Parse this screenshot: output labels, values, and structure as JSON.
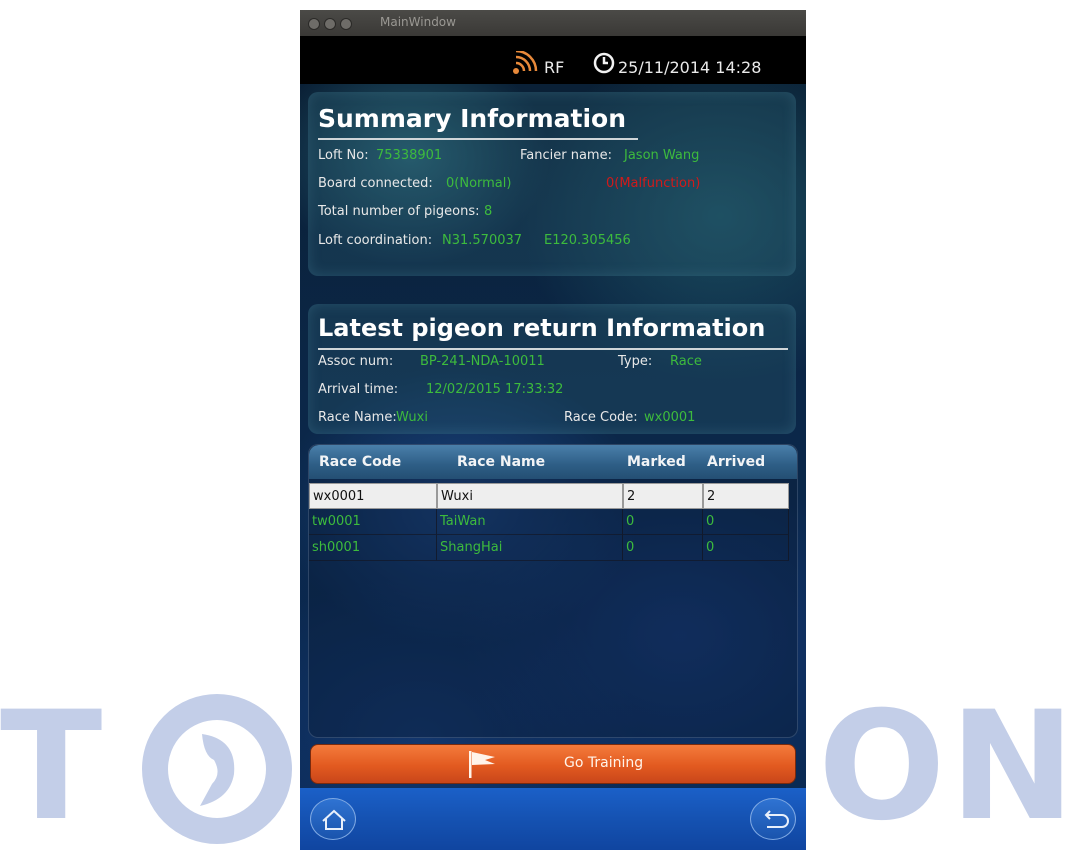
{
  "watermark": {
    "letters_left": "T",
    "letters_right": "ON"
  },
  "window": {
    "title": "MainWindow"
  },
  "status": {
    "rf_label": "RF",
    "datetime": "25/11/2014 14:28"
  },
  "summary": {
    "title": "Summary Information",
    "loft_no_label": "Loft No:",
    "loft_no": "75338901",
    "fancier_label": "Fancier name:",
    "fancier": "Jason Wang",
    "board_label": "Board connected:",
    "board_value": "0(Normal)",
    "board_error": "0(Malfunction)",
    "total_label": "Total number of pigeons:",
    "total_value": "8",
    "coord_label": "Loft coordination:",
    "coord_n": "N31.570037",
    "coord_e": "E120.305456"
  },
  "latest": {
    "title": "Latest pigeon return Information",
    "assoc_label": "Assoc num:",
    "assoc_value": "BP-241-NDA-10011",
    "type_label": "Type:",
    "type_value": "Race",
    "arrival_label": "Arrival time:",
    "arrival_value": "12/02/2015 17:33:32",
    "race_name_label": "Race Name:",
    "race_name_value": "Wuxi",
    "race_code_label": "Race Code:",
    "race_code_value": "wx0001"
  },
  "table": {
    "headers": [
      "Race Code",
      "Race Name",
      "Marked",
      "Arrived"
    ],
    "rows": [
      {
        "code": "wx0001",
        "name": "Wuxi",
        "marked": "2",
        "arrived": "2",
        "selected": true
      },
      {
        "code": "tw0001",
        "name": "TaiWan",
        "marked": "0",
        "arrived": "0",
        "selected": false
      },
      {
        "code": "sh0001",
        "name": "ShangHai",
        "marked": "0",
        "arrived": "0",
        "selected": false
      }
    ]
  },
  "actions": {
    "go_training": "Go Training"
  },
  "icons": [
    "rf-signal-icon",
    "clock-icon",
    "flag-icon",
    "home-icon",
    "back-icon",
    "pigeon-logo-icon"
  ],
  "colors": {
    "value_green": "#3dbb3d",
    "error_red": "#d11a1a",
    "button_orange": "#e25a20",
    "nav_blue": "#1552b2",
    "watermark": "#c3cee8"
  }
}
